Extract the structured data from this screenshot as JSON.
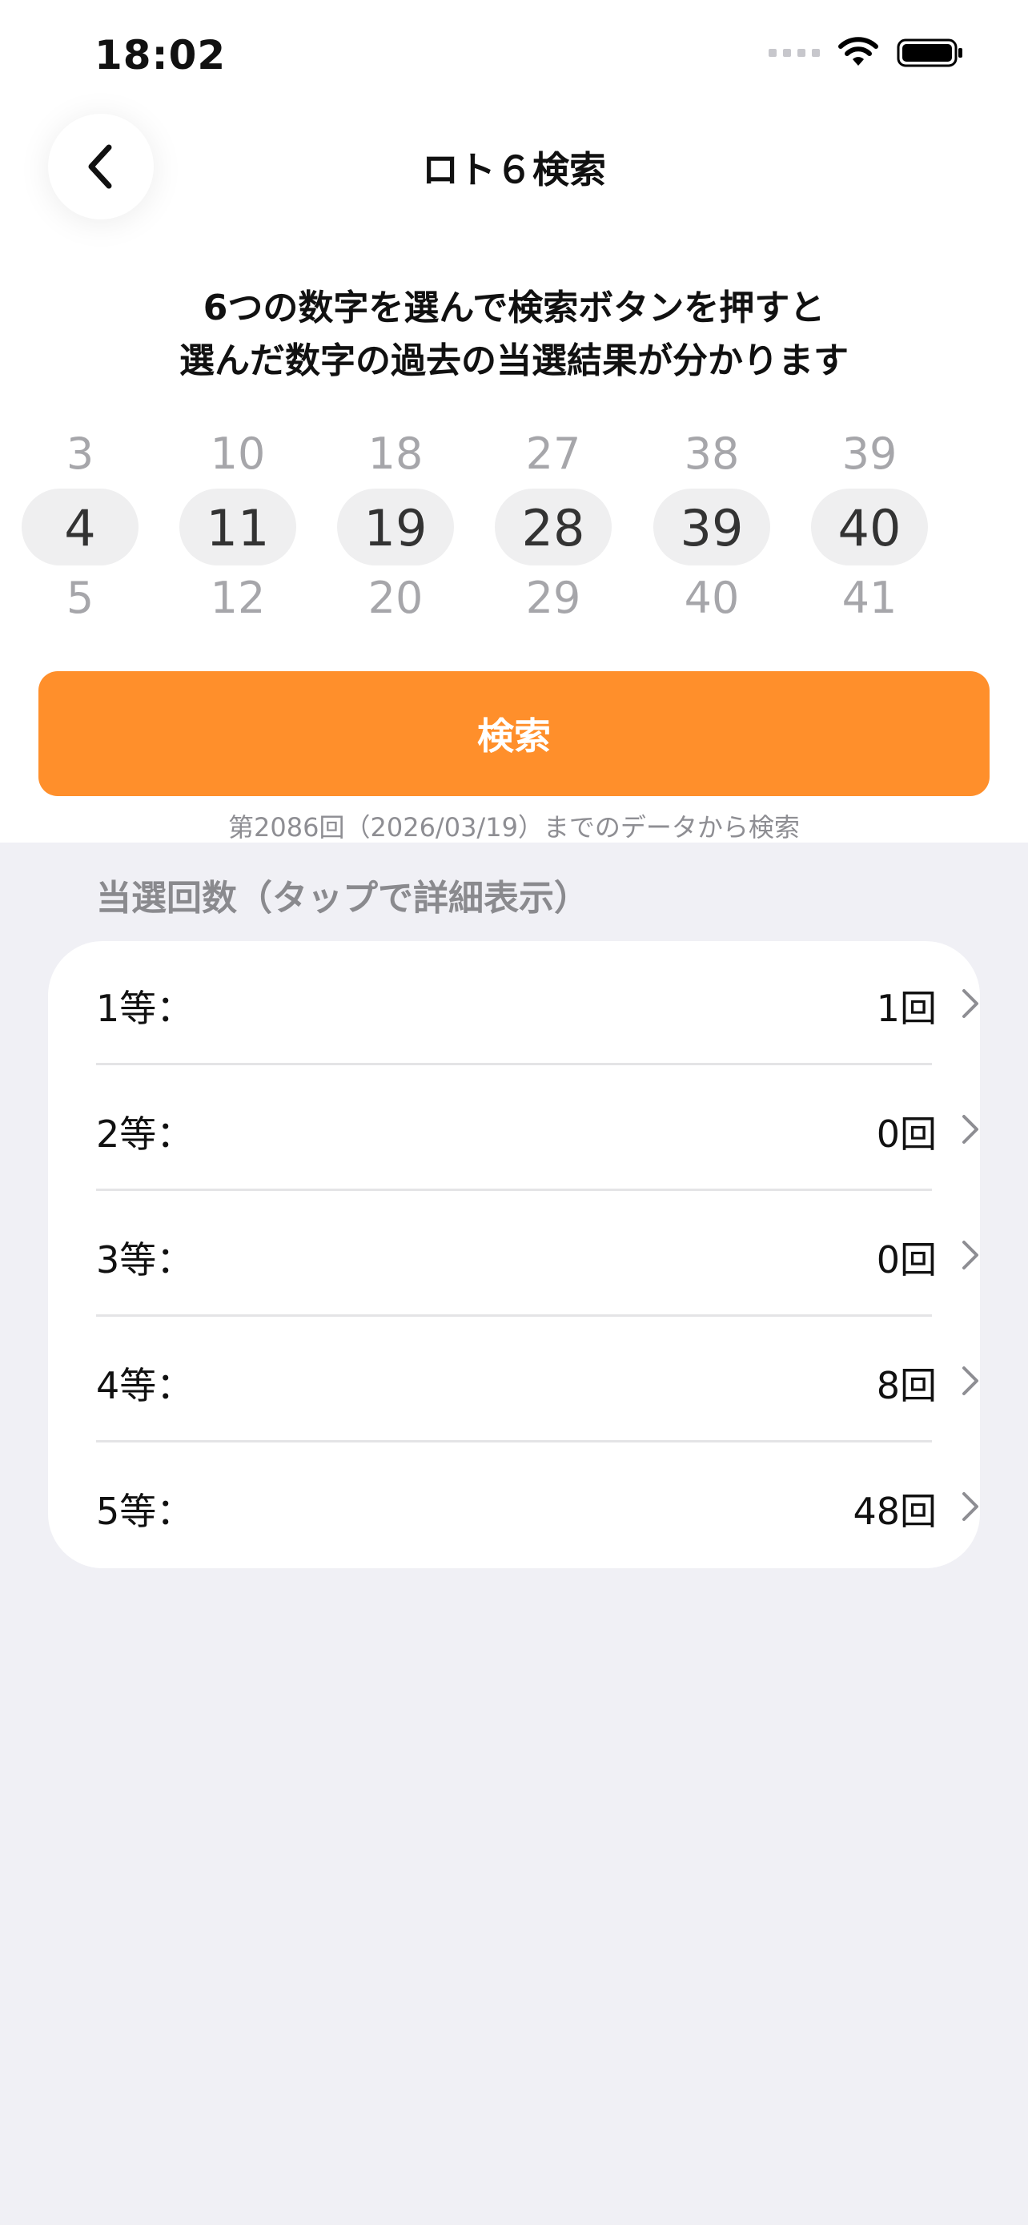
{
  "status_bar": {
    "time": "18:02"
  },
  "nav": {
    "title": "ロト６検索"
  },
  "instructions": {
    "line1": "6つの数字を選んで検索ボタンを押すと",
    "line2": "選んだ数字の過去の当選結果が分かります"
  },
  "picker": {
    "columns": [
      {
        "above": "3",
        "selected": "4",
        "below": "5"
      },
      {
        "above": "10",
        "selected": "11",
        "below": "12"
      },
      {
        "above": "18",
        "selected": "19",
        "below": "20"
      },
      {
        "above": "27",
        "selected": "28",
        "below": "29"
      },
      {
        "above": "38",
        "selected": "39",
        "below": "40"
      },
      {
        "above": "39",
        "selected": "40",
        "below": "41"
      }
    ]
  },
  "search": {
    "button_label": "検索",
    "note": "第2086回（2026/03/19）までのデータから検索"
  },
  "results": {
    "header": "当選回数（タップで詳細表示）",
    "rows": [
      {
        "label": "1等：",
        "value": "1回"
      },
      {
        "label": "2等：",
        "value": "0回"
      },
      {
        "label": "3等：",
        "value": "0回"
      },
      {
        "label": "4等：",
        "value": "8回"
      },
      {
        "label": "5等：",
        "value": "48回"
      }
    ]
  },
  "colors": {
    "accent": "#ff8f2b",
    "background": "#f0f0f5"
  }
}
